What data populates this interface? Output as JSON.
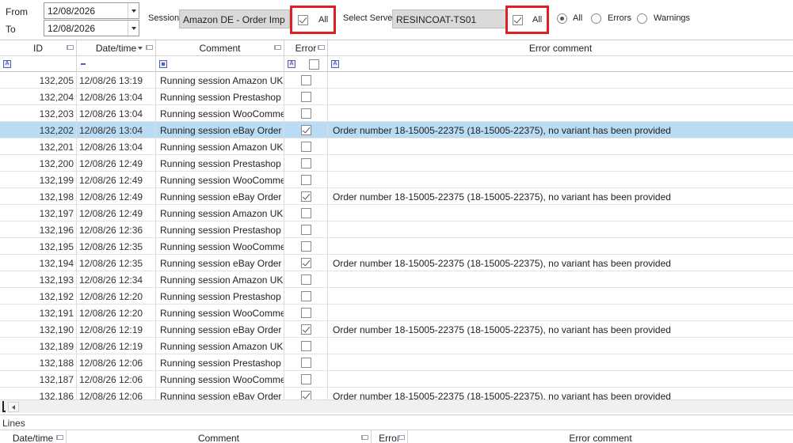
{
  "filters": {
    "from_label": "From",
    "from_value": "12/08/2026",
    "to_label": "To",
    "to_value": "12/08/2026",
    "session_label": "Session",
    "session_value": "Amazon DE - Order Imp",
    "session_all_label": "All",
    "server_label": "Select Server",
    "server_value": "RESINCOAT-TS01",
    "server_all_label": "All",
    "radio_all": "All",
    "radio_errors": "Errors",
    "radio_warnings": "Warnings"
  },
  "grid": {
    "columns": [
      "ID",
      "Date/time",
      "Comment",
      "Error",
      "Error comment"
    ],
    "rows": [
      {
        "id": "132,205",
        "dt": "12/08/26 13:19",
        "comment": "Running session Amazon UK -",
        "error": false,
        "error_comment": ""
      },
      {
        "id": "132,204",
        "dt": "12/08/26 13:04",
        "comment": "Running session Prestashop",
        "error": false,
        "error_comment": ""
      },
      {
        "id": "132,203",
        "dt": "12/08/26 13:04",
        "comment": "Running session WooCommer",
        "error": false,
        "error_comment": ""
      },
      {
        "id": "132,202",
        "dt": "12/08/26 13:04",
        "comment": "Running session eBay Order I",
        "error": true,
        "error_comment": "Order number 18-15005-22375 (18-15005-22375), no variant has been provided",
        "selected": true
      },
      {
        "id": "132,201",
        "dt": "12/08/26 13:04",
        "comment": "Running session Amazon UK -",
        "error": false,
        "error_comment": ""
      },
      {
        "id": "132,200",
        "dt": "12/08/26 12:49",
        "comment": "Running session Prestashop",
        "error": false,
        "error_comment": ""
      },
      {
        "id": "132,199",
        "dt": "12/08/26 12:49",
        "comment": "Running session WooCommer",
        "error": false,
        "error_comment": ""
      },
      {
        "id": "132,198",
        "dt": "12/08/26 12:49",
        "comment": "Running session eBay Order I",
        "error": true,
        "error_comment": "Order number 18-15005-22375 (18-15005-22375), no variant has been provided"
      },
      {
        "id": "132,197",
        "dt": "12/08/26 12:49",
        "comment": "Running session Amazon UK -",
        "error": false,
        "error_comment": ""
      },
      {
        "id": "132,196",
        "dt": "12/08/26 12:36",
        "comment": "Running session Prestashop",
        "error": false,
        "error_comment": ""
      },
      {
        "id": "132,195",
        "dt": "12/08/26 12:35",
        "comment": "Running session WooCommer",
        "error": false,
        "error_comment": ""
      },
      {
        "id": "132,194",
        "dt": "12/08/26 12:35",
        "comment": "Running session eBay Order I",
        "error": true,
        "error_comment": "Order number 18-15005-22375 (18-15005-22375), no variant has been provided"
      },
      {
        "id": "132,193",
        "dt": "12/08/26 12:34",
        "comment": "Running session Amazon UK -",
        "error": false,
        "error_comment": ""
      },
      {
        "id": "132,192",
        "dt": "12/08/26 12:20",
        "comment": "Running session Prestashop",
        "error": false,
        "error_comment": ""
      },
      {
        "id": "132,191",
        "dt": "12/08/26 12:20",
        "comment": "Running session WooCommer",
        "error": false,
        "error_comment": ""
      },
      {
        "id": "132,190",
        "dt": "12/08/26 12:19",
        "comment": "Running session eBay Order I",
        "error": true,
        "error_comment": "Order number 18-15005-22375 (18-15005-22375), no variant has been provided"
      },
      {
        "id": "132,189",
        "dt": "12/08/26 12:19",
        "comment": "Running session Amazon UK -",
        "error": false,
        "error_comment": ""
      },
      {
        "id": "132,188",
        "dt": "12/08/26 12:06",
        "comment": "Running session Prestashop",
        "error": false,
        "error_comment": ""
      },
      {
        "id": "132,187",
        "dt": "12/08/26 12:06",
        "comment": "Running session WooCommer",
        "error": false,
        "error_comment": ""
      },
      {
        "id": "132,186",
        "dt": "12/08/26 12:06",
        "comment": "Running session eBay Order I",
        "error": true,
        "error_comment": "Order number 18-15005-22375 (18-15005-22375), no variant has been provided"
      }
    ]
  },
  "lines": {
    "label": "Lines",
    "columns": [
      "Date/time",
      "Comment",
      "Error",
      "Error comment"
    ]
  },
  "colors": {
    "selection": "#b9dbf3",
    "highlight_border": "#e01e25",
    "filter_icon": "#4e61b5"
  }
}
